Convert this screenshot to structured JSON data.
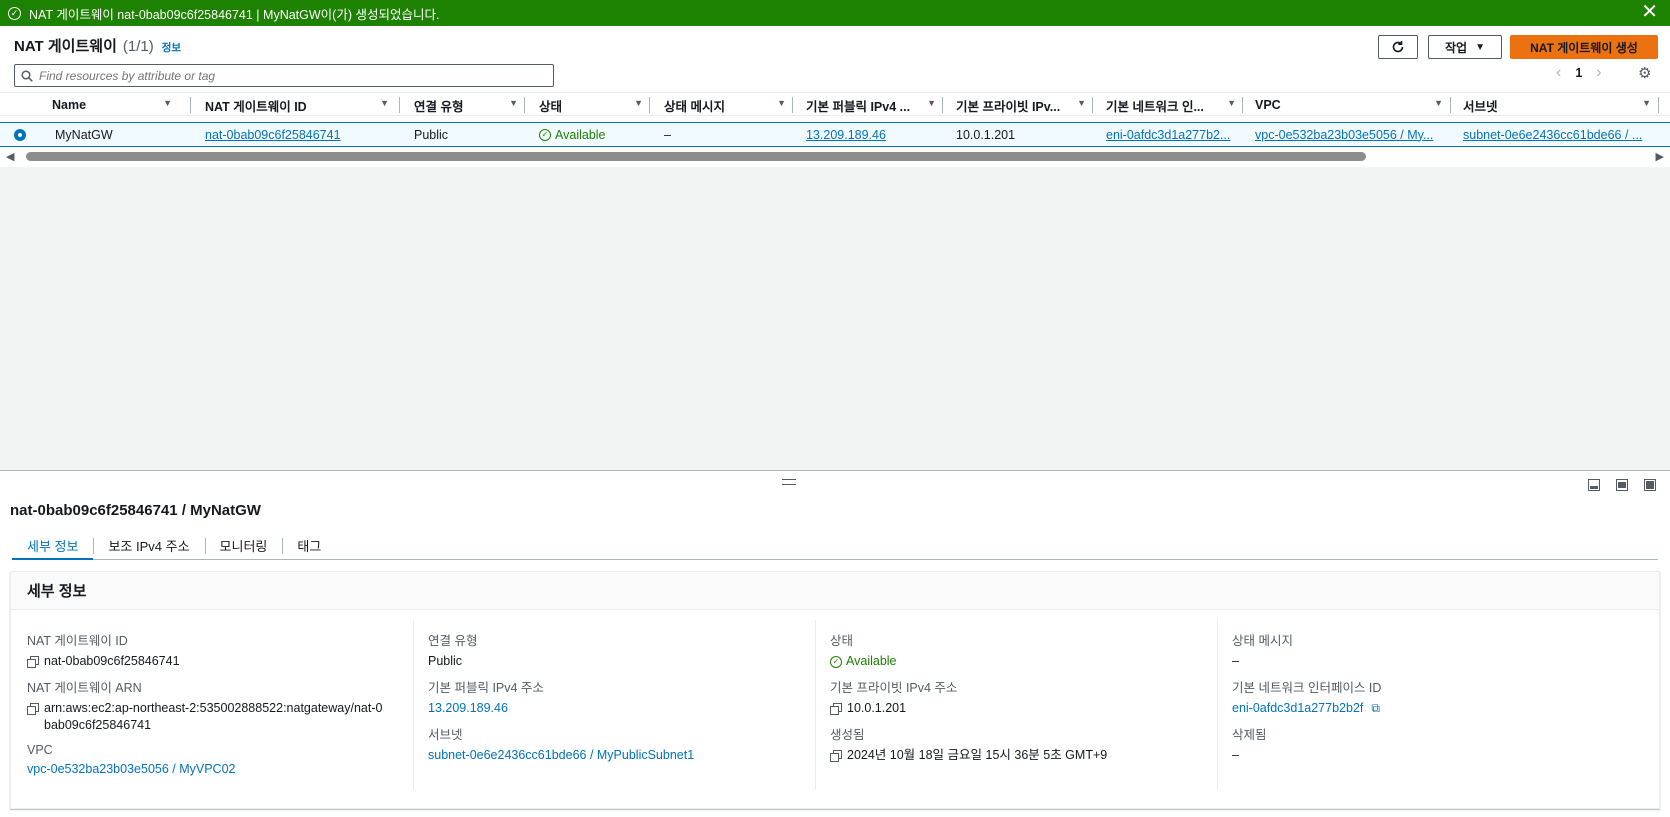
{
  "flash": {
    "message": "NAT 게이트웨이 nat-0bab09c6f25846741 | MyNatGW이(가) 생성되었습니다.",
    "close": "✕"
  },
  "header": {
    "title": "NAT 게이트웨이",
    "count": "(1/1)",
    "info": "정보",
    "action_label": "작업",
    "create_label": "NAT 게이트웨이 생성"
  },
  "search": {
    "placeholder": "Find resources by attribute or tag"
  },
  "pagination": {
    "page": "1"
  },
  "table": {
    "columns": [
      "Name",
      "NAT 게이트웨이 ID",
      "연결 유형",
      "상태",
      "상태 메시지",
      "기본 퍼블릭 IPv4 ...",
      "기본 프라이빗 IPv...",
      "기본 네트워크 인...",
      "VPC",
      "서브넷"
    ],
    "row": {
      "name": "MyNatGW",
      "id": "nat-0bab09c6f25846741",
      "connectivity": "Public",
      "state": "Available",
      "state_message": "–",
      "public_ip": "13.209.189.46",
      "private_ip": "10.0.1.201",
      "eni": "eni-0afdc3d1a277b2...",
      "vpc": "vpc-0e532ba23b03e5056 / My...",
      "subnet": "subnet-0e6e2436cc61bde66 / ..."
    }
  },
  "split": {
    "title": "nat-0bab09c6f25846741 / MyNatGW",
    "tabs": [
      "세부 정보",
      "보조 IPv4 주소",
      "모니터링",
      "태그"
    ]
  },
  "details": {
    "header": "세부 정보",
    "fields": {
      "nat_id_label": "NAT 게이트웨이 ID",
      "nat_id": "nat-0bab09c6f25846741",
      "arn_label": "NAT 게이트웨이 ARN",
      "arn": "arn:aws:ec2:ap-northeast-2:535002888522:natgateway/nat-0bab09c6f25846741",
      "vpc_label": "VPC",
      "vpc": "vpc-0e532ba23b03e5056 / MyVPC02",
      "connectivity_label": "연결 유형",
      "connectivity": "Public",
      "public_ip_label": "기본 퍼블릭 IPv4 주소",
      "public_ip": "13.209.189.46",
      "subnet_label": "서브넷",
      "subnet": "subnet-0e6e2436cc61bde66 / MyPublicSubnet1",
      "state_label": "상태",
      "state": "Available",
      "private_ip_label": "기본 프라이빗 IPv4 주소",
      "private_ip": "10.0.1.201",
      "created_label": "생성됨",
      "created": "2024년 10월 18일 금요일 15시 36분 5초 GMT+9",
      "state_message_label": "상태 메시지",
      "state_message": "–",
      "eni_label": "기본 네트워크 인터페이스 ID",
      "eni": "eni-0afdc3d1a277b2b2f",
      "deleted_label": "삭제됨",
      "deleted": "–"
    }
  },
  "colors": {
    "success": "#1d8102",
    "link": "#0073bb",
    "primary": "#ec7211"
  }
}
